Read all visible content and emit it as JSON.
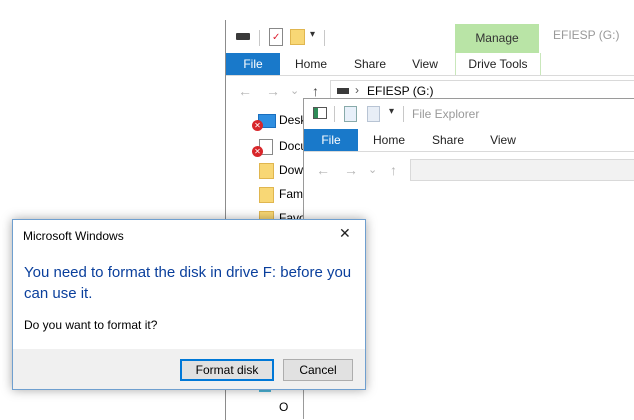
{
  "back_window": {
    "manage_label": "Manage",
    "title": "EFIESP (G:)",
    "tabs": [
      "File",
      "Home",
      "Share",
      "View",
      "Drive Tools"
    ],
    "address": "EFIESP (G:)",
    "address_chevron": "›",
    "nav_items": [
      "Desk",
      "Docu",
      "Dow",
      "Fami",
      "Favo",
      "3D O"
    ],
    "colors": {
      "manage_bg": "#b9e4a6",
      "file_tab": "#1979ca"
    }
  },
  "front_window": {
    "title": "File Explorer",
    "tabs": [
      "File",
      "Home",
      "Share",
      "View"
    ]
  },
  "dialog": {
    "title": "Microsoft Windows",
    "close_glyph": "✕",
    "heading": "You need to format the disk in drive F: before you can use it.",
    "question": "Do you want to format it?",
    "format_button": "Format disk",
    "cancel_button": "Cancel",
    "colors": {
      "heading": "#0a3f9c"
    }
  },
  "icons": {
    "back": "←",
    "forward": "→",
    "up": "↑",
    "chevron_down": "⌄",
    "qat_dropdown": "▾"
  }
}
